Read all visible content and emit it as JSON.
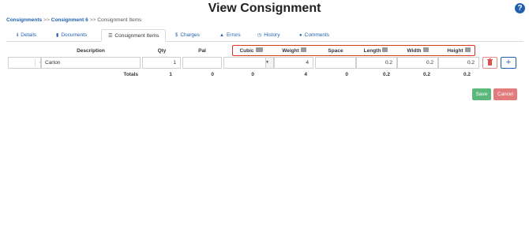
{
  "page": {
    "title": "View Consignment",
    "help_icon": "question-circle-icon"
  },
  "breadcrumb": {
    "item1": "Consignments",
    "item2": "Consignment 6",
    "item3": "Consignment Items",
    "separator": ">>"
  },
  "tabs": [
    {
      "label": "Details",
      "icon": "info-icon"
    },
    {
      "label": "Documents",
      "icon": "document-icon"
    },
    {
      "label": "Consignment Items",
      "icon": "list-icon"
    },
    {
      "label": "Charges",
      "icon": "dollar-icon"
    },
    {
      "label": "Errors",
      "icon": "warning-icon"
    },
    {
      "label": "History",
      "icon": "clock-icon"
    },
    {
      "label": "Comments",
      "icon": "comment-icon"
    }
  ],
  "table": {
    "headers": {
      "description": "Description",
      "qty": "Qty",
      "pal": "Pal",
      "cubic": "Cubic",
      "weight": "Weight",
      "space": "Space",
      "length": "Length",
      "width": "Width",
      "height": "Height"
    },
    "row": {
      "description": "Carton",
      "qty": "1",
      "pal": "",
      "cubic": "",
      "weight": "4",
      "space": "",
      "length": "0.2",
      "width": "0.2",
      "height": "0.2"
    },
    "totals": {
      "label": "Totals",
      "qty": "1",
      "pal": "0",
      "cubic": "0",
      "weight": "4",
      "space": "0",
      "length": "0.2",
      "width": "0.2",
      "height": "0.2"
    }
  },
  "actions": {
    "save": "Save",
    "cancel": "Cancel"
  },
  "colors": {
    "link": "#1f5fb0",
    "highlight_box": "#d93a1c",
    "save": "#5cb87a",
    "cancel": "#e27b7b"
  }
}
